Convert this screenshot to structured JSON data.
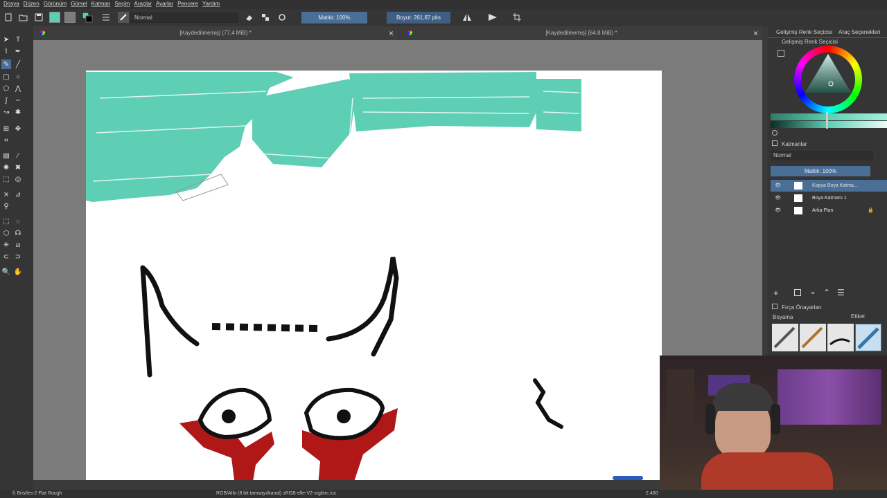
{
  "menu": [
    "Dosya",
    "Düzen",
    "Görünüm",
    "Görsel",
    "Katman",
    "Seçim",
    "Araçlar",
    "Ayarlar",
    "Pencere",
    "Yardım"
  ],
  "toolbar": {
    "blend_mode": "Normal",
    "opacity_label": "Matlık: 100%",
    "size_label": "Boyut: 261,87 pks"
  },
  "tabs": [
    {
      "title": "[Kaydedilmemiş]  (77,4 MiB) *",
      "close": "×"
    },
    {
      "title": "[Kaydedilmemiş]  (64,8 MiB) *",
      "close": "×"
    }
  ],
  "docker": {
    "tab_color": "Gelişmiş Renk Seçicisi",
    "tab_tools": "Araç Seçenekleri",
    "color_title": "Gelişmiş Renk Seçicisi",
    "layers_title": "Katmanlar",
    "layer_blend": "Normal",
    "layer_opacity": "Matlık:  100%",
    "layers": [
      {
        "name": "Kopya Boya Katma...",
        "selected": true,
        "locked": false
      },
      {
        "name": "Boya Katmanı 1",
        "selected": false,
        "locked": false
      },
      {
        "name": "Arka Plan",
        "selected": false,
        "locked": true
      }
    ],
    "brush_title": "Fırça Önayarları",
    "brush_tag": "Boyama",
    "brush_tag_btn": "Etiket"
  },
  "status": {
    "brush": "f) Bristles-2 Flat Rough",
    "color_profile": "RGB/Alfa (8 bit tamsayı/kanal)  sRGB-elle-V2-srgbtrc.icc",
    "zoom": "2.480"
  },
  "colors": {
    "teal": "#5ecfb4",
    "red": "#b01818",
    "accent": "#4a6f96"
  }
}
